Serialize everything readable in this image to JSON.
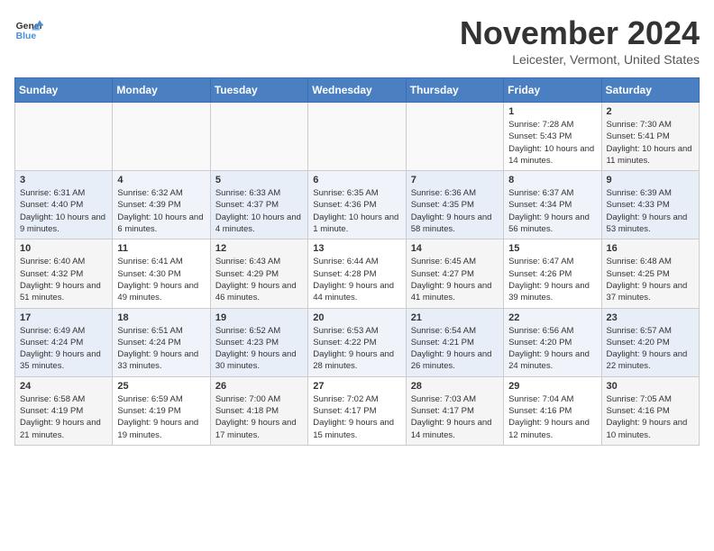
{
  "header": {
    "logo": {
      "general": "General",
      "blue": "Blue"
    },
    "title": "November 2024",
    "subtitle": "Leicester, Vermont, United States"
  },
  "weekdays": [
    "Sunday",
    "Monday",
    "Tuesday",
    "Wednesday",
    "Thursday",
    "Friday",
    "Saturday"
  ],
  "weeks": [
    [
      {
        "day": "",
        "info": ""
      },
      {
        "day": "",
        "info": ""
      },
      {
        "day": "",
        "info": ""
      },
      {
        "day": "",
        "info": ""
      },
      {
        "day": "",
        "info": ""
      },
      {
        "day": "1",
        "info": "Sunrise: 7:28 AM\nSunset: 5:43 PM\nDaylight: 10 hours and 14 minutes."
      },
      {
        "day": "2",
        "info": "Sunrise: 7:30 AM\nSunset: 5:41 PM\nDaylight: 10 hours and 11 minutes."
      }
    ],
    [
      {
        "day": "3",
        "info": "Sunrise: 6:31 AM\nSunset: 4:40 PM\nDaylight: 10 hours and 9 minutes."
      },
      {
        "day": "4",
        "info": "Sunrise: 6:32 AM\nSunset: 4:39 PM\nDaylight: 10 hours and 6 minutes."
      },
      {
        "day": "5",
        "info": "Sunrise: 6:33 AM\nSunset: 4:37 PM\nDaylight: 10 hours and 4 minutes."
      },
      {
        "day": "6",
        "info": "Sunrise: 6:35 AM\nSunset: 4:36 PM\nDaylight: 10 hours and 1 minute."
      },
      {
        "day": "7",
        "info": "Sunrise: 6:36 AM\nSunset: 4:35 PM\nDaylight: 9 hours and 58 minutes."
      },
      {
        "day": "8",
        "info": "Sunrise: 6:37 AM\nSunset: 4:34 PM\nDaylight: 9 hours and 56 minutes."
      },
      {
        "day": "9",
        "info": "Sunrise: 6:39 AM\nSunset: 4:33 PM\nDaylight: 9 hours and 53 minutes."
      }
    ],
    [
      {
        "day": "10",
        "info": "Sunrise: 6:40 AM\nSunset: 4:32 PM\nDaylight: 9 hours and 51 minutes."
      },
      {
        "day": "11",
        "info": "Sunrise: 6:41 AM\nSunset: 4:30 PM\nDaylight: 9 hours and 49 minutes."
      },
      {
        "day": "12",
        "info": "Sunrise: 6:43 AM\nSunset: 4:29 PM\nDaylight: 9 hours and 46 minutes."
      },
      {
        "day": "13",
        "info": "Sunrise: 6:44 AM\nSunset: 4:28 PM\nDaylight: 9 hours and 44 minutes."
      },
      {
        "day": "14",
        "info": "Sunrise: 6:45 AM\nSunset: 4:27 PM\nDaylight: 9 hours and 41 minutes."
      },
      {
        "day": "15",
        "info": "Sunrise: 6:47 AM\nSunset: 4:26 PM\nDaylight: 9 hours and 39 minutes."
      },
      {
        "day": "16",
        "info": "Sunrise: 6:48 AM\nSunset: 4:25 PM\nDaylight: 9 hours and 37 minutes."
      }
    ],
    [
      {
        "day": "17",
        "info": "Sunrise: 6:49 AM\nSunset: 4:24 PM\nDaylight: 9 hours and 35 minutes."
      },
      {
        "day": "18",
        "info": "Sunrise: 6:51 AM\nSunset: 4:24 PM\nDaylight: 9 hours and 33 minutes."
      },
      {
        "day": "19",
        "info": "Sunrise: 6:52 AM\nSunset: 4:23 PM\nDaylight: 9 hours and 30 minutes."
      },
      {
        "day": "20",
        "info": "Sunrise: 6:53 AM\nSunset: 4:22 PM\nDaylight: 9 hours and 28 minutes."
      },
      {
        "day": "21",
        "info": "Sunrise: 6:54 AM\nSunset: 4:21 PM\nDaylight: 9 hours and 26 minutes."
      },
      {
        "day": "22",
        "info": "Sunrise: 6:56 AM\nSunset: 4:20 PM\nDaylight: 9 hours and 24 minutes."
      },
      {
        "day": "23",
        "info": "Sunrise: 6:57 AM\nSunset: 4:20 PM\nDaylight: 9 hours and 22 minutes."
      }
    ],
    [
      {
        "day": "24",
        "info": "Sunrise: 6:58 AM\nSunset: 4:19 PM\nDaylight: 9 hours and 21 minutes."
      },
      {
        "day": "25",
        "info": "Sunrise: 6:59 AM\nSunset: 4:19 PM\nDaylight: 9 hours and 19 minutes."
      },
      {
        "day": "26",
        "info": "Sunrise: 7:00 AM\nSunset: 4:18 PM\nDaylight: 9 hours and 17 minutes."
      },
      {
        "day": "27",
        "info": "Sunrise: 7:02 AM\nSunset: 4:17 PM\nDaylight: 9 hours and 15 minutes."
      },
      {
        "day": "28",
        "info": "Sunrise: 7:03 AM\nSunset: 4:17 PM\nDaylight: 9 hours and 14 minutes."
      },
      {
        "day": "29",
        "info": "Sunrise: 7:04 AM\nSunset: 4:16 PM\nDaylight: 9 hours and 12 minutes."
      },
      {
        "day": "30",
        "info": "Sunrise: 7:05 AM\nSunset: 4:16 PM\nDaylight: 9 hours and 10 minutes."
      }
    ]
  ]
}
